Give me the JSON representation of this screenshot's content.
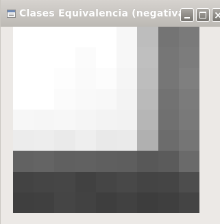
{
  "window": {
    "title": "Clases Equivalencia (negativa)",
    "icons": {
      "app": "app-icon",
      "minimize": "minimize-icon",
      "maximize": "maximize-icon",
      "close": "close-icon"
    },
    "close_glyph": "×"
  },
  "canvas": {
    "rows": 9,
    "cols": 9,
    "cell_colors": [
      [
        "#ffffff",
        "#ffffff",
        "#ffffff",
        "#ffffff",
        "#ffffff",
        "#f7f7f7",
        "#bdbdbd",
        "#747474",
        "#7a7a7a"
      ],
      [
        "#ffffff",
        "#ffffff",
        "#ffffff",
        "#fbfbfb",
        "#ffffff",
        "#f7f7f7",
        "#bfbfbf",
        "#767676",
        "#7c7c7c"
      ],
      [
        "#ffffff",
        "#ffffff",
        "#fdfdfd",
        "#fafafa",
        "#fcfcfc",
        "#f5f5f5",
        "#bdbdbd",
        "#767676",
        "#7f7f7f"
      ],
      [
        "#ffffff",
        "#ffffff",
        "#fbfbfb",
        "#f9f9f9",
        "#f8f8f8",
        "#f3f3f3",
        "#bababa",
        "#727272",
        "#7b7b7b"
      ],
      [
        "#f7f7f7",
        "#f6f6f6",
        "#f7f7f7",
        "#f5f5f5",
        "#f3f3f3",
        "#f2f2f2",
        "#b6b6b6",
        "#707070",
        "#797979"
      ],
      [
        "#ececec",
        "#ededed",
        "#eaeaea",
        "#eeeeee",
        "#e9e9e9",
        "#eaeaea",
        "#b0b0b0",
        "#6c6c6c",
        "#757575"
      ],
      [
        "#626262",
        "#646464",
        "#606060",
        "#616161",
        "#5f5f5f",
        "#5e5e5e",
        "#585858",
        "#5b5b5b",
        "#6a6a6a"
      ],
      [
        "#434343",
        "#454545",
        "#464646",
        "#414141",
        "#454545",
        "#484848",
        "#444444",
        "#454545",
        "#4d4d4d"
      ],
      [
        "#3f3f3f",
        "#404040",
        "#454545",
        "#424242",
        "#3e3e3e",
        "#414141",
        "#3d3d3d",
        "#3f3f3f",
        "#444444"
      ]
    ]
  }
}
